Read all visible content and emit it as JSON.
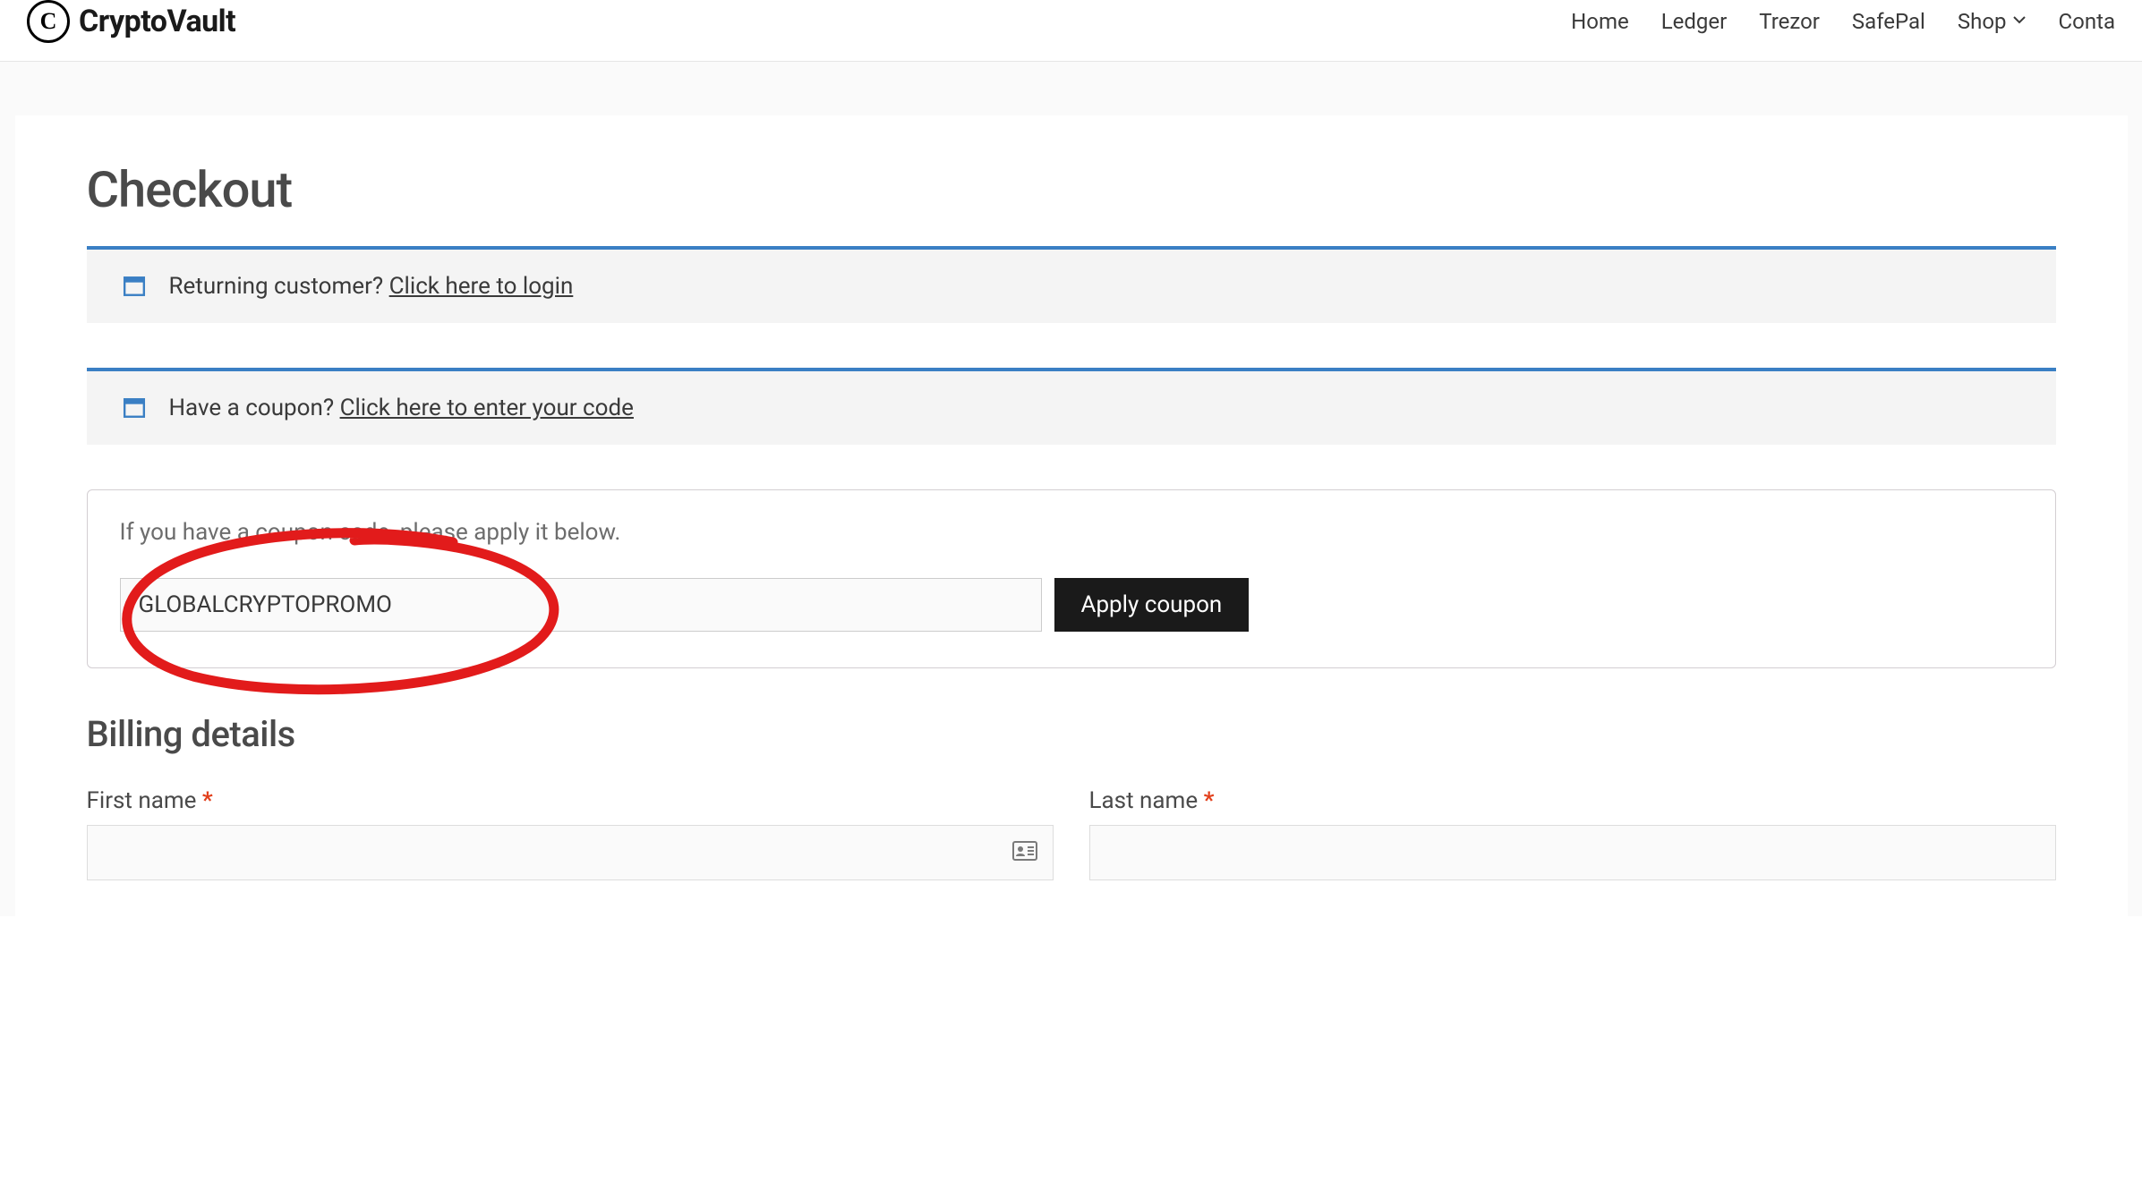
{
  "header": {
    "logo_letter": "C",
    "brand_name": "CryptoVault",
    "nav": {
      "home": "Home",
      "ledger": "Ledger",
      "trezor": "Trezor",
      "safepal": "SafePal",
      "shop": "Shop",
      "contact": "Conta"
    }
  },
  "page": {
    "title": "Checkout",
    "returning_prefix": "Returning customer? ",
    "returning_link": "Click here to login",
    "coupon_prefix": "Have a coupon? ",
    "coupon_link": "Click here to enter your code",
    "coupon_hint": "If you have a coupon code, please apply it below.",
    "coupon_value": "GLOBALCRYPTOPROMO",
    "apply_label": "Apply coupon",
    "billing_title": "Billing details",
    "fields": {
      "first_name_label": "First name",
      "last_name_label": "Last name",
      "required_mark": "*"
    }
  }
}
